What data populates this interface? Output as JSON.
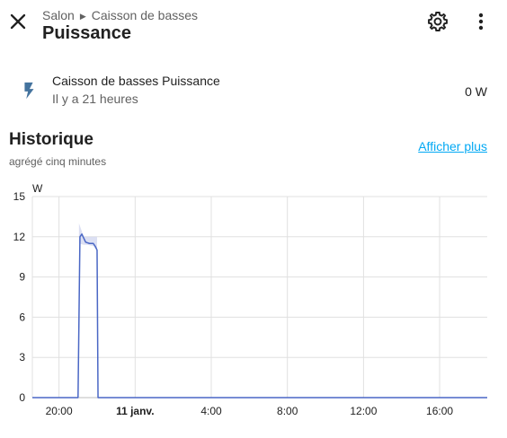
{
  "header": {
    "breadcrumb_area": "Salon",
    "breadcrumb_device": "Caisson de basses",
    "title": "Puissance",
    "icons": [
      "close-icon",
      "settings-icon",
      "more-vertical-icon"
    ]
  },
  "entity": {
    "icon": "flash-icon",
    "name": "Caisson de basses Puissance",
    "last_changed": "Il y a 21 heures",
    "state": "0 W"
  },
  "history": {
    "title": "Historique",
    "subtitle": "agrégé cinq minutes",
    "show_more_label": "Afficher plus"
  },
  "colors": {
    "accent": "#03a9f4",
    "line": "#4a67c5",
    "band": "#d3d8f0",
    "grid": "#e0e0e0"
  },
  "chart_data": {
    "type": "line",
    "unit_label": "W",
    "ylim": [
      0,
      15
    ],
    "y_ticks": [
      "0",
      "3",
      "6",
      "9",
      "12",
      "15"
    ],
    "x_ticks": [
      {
        "label": "20:00",
        "hour": 20,
        "bold": false
      },
      {
        "label": "11 janv.",
        "hour": 24,
        "bold": true
      },
      {
        "label": "4:00",
        "hour": 28,
        "bold": false
      },
      {
        "label": "8:00",
        "hour": 32,
        "bold": false
      },
      {
        "label": "12:00",
        "hour": 36,
        "bold": false
      },
      {
        "label": "16:00",
        "hour": 40,
        "bold": false
      }
    ],
    "xlim": [
      18.6,
      42.5
    ],
    "grid": true,
    "series": [
      {
        "values": [
          [
            18.6,
            0
          ],
          [
            21.0,
            0
          ],
          [
            21.05,
            6
          ],
          [
            21.1,
            12.0
          ],
          [
            21.2,
            12.2
          ],
          [
            21.3,
            11.9
          ],
          [
            21.4,
            11.6
          ],
          [
            21.6,
            11.5
          ],
          [
            21.8,
            11.5
          ],
          [
            21.9,
            11.3
          ],
          [
            22.0,
            11.0
          ],
          [
            22.05,
            0
          ],
          [
            42.5,
            0
          ]
        ],
        "band": [
          [
            21.05,
            11.5,
            13.0
          ],
          [
            21.3,
            11.4,
            12.0
          ],
          [
            21.5,
            11.4,
            12.0
          ],
          [
            21.8,
            11.3,
            12.0
          ],
          [
            22.0,
            11.0,
            12.0
          ]
        ]
      }
    ]
  }
}
